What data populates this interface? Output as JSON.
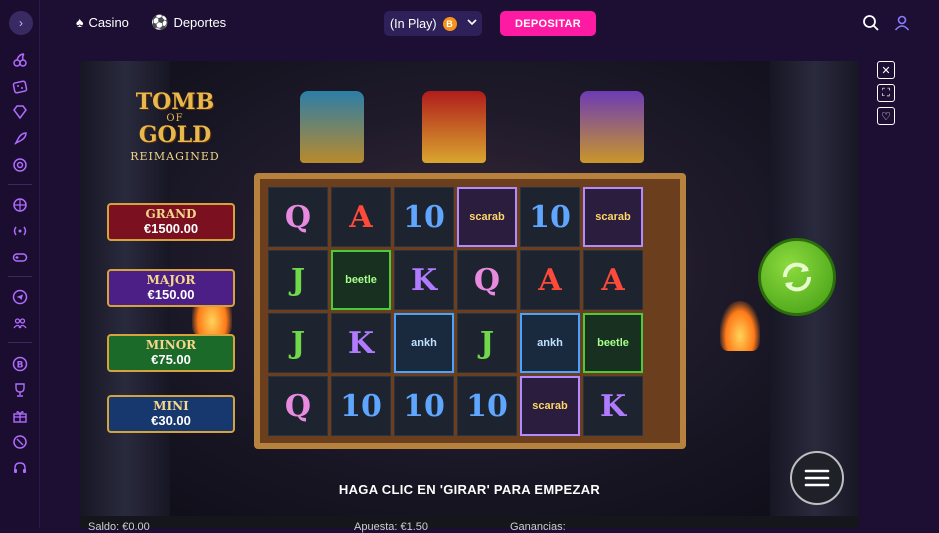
{
  "topbar": {
    "nav": [
      {
        "label": "Casino",
        "icon": "spade-icon"
      },
      {
        "label": "Deportes",
        "icon": "soccer-ball-icon"
      }
    ],
    "balance_label": "(In Play)",
    "currency_icon": "B",
    "deposit_label": "DEPOSITAR"
  },
  "sidebar": {
    "toggle": "›",
    "icons": [
      "cherry-icon",
      "dice-icon",
      "diamond-icon",
      "rocket-icon",
      "chip-icon",
      "basketball-icon",
      "broadcast-icon",
      "gamepad-icon",
      "telegram-icon",
      "users-icon",
      "bitcoin-icon",
      "trophy-icon",
      "gift-icon",
      "chip-icon",
      "headset-icon"
    ]
  },
  "game": {
    "logo_line1": "TOMB",
    "logo_line2": "OF",
    "logo_line3": "GOLD",
    "logo_sub": "REIMAGINED",
    "jackpots": [
      {
        "name": "GRAND",
        "value": "€1500.00",
        "color": "#7a1020"
      },
      {
        "name": "MAJOR",
        "value": "€150.00",
        "color": "#4b1f86"
      },
      {
        "name": "MINOR",
        "value": "€75.00",
        "color": "#1b6a2a"
      },
      {
        "name": "MINI",
        "value": "€30.00",
        "color": "#17386e"
      }
    ],
    "grid": [
      [
        "Q",
        "A",
        "10",
        "scarab",
        "10",
        "scarab"
      ],
      [
        "J",
        "beetle",
        "K",
        "Q",
        "A",
        "A"
      ],
      [
        "J",
        "K",
        "ankh",
        "J",
        "ankh",
        "beetle"
      ],
      [
        "Q",
        "10",
        "10",
        "10",
        "scarab",
        "K"
      ]
    ],
    "message": "HAGA CLIC EN 'GIRAR' PARA EMPEZAR"
  },
  "bottombar": {
    "balance": "Saldo: €0.00",
    "bet": "Apuesta: €1.50",
    "win": "Ganancias:"
  },
  "colors": {
    "accent": "#ff1aa3",
    "sidebar_icon": "#b06cff",
    "background": "#1c0f33"
  }
}
